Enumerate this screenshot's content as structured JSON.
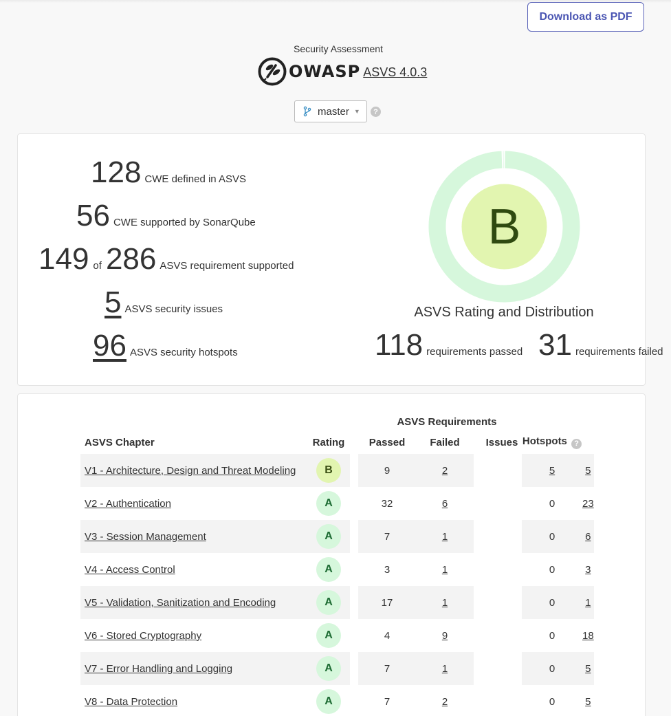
{
  "header": {
    "download_label": "Download as PDF",
    "assessment_label": "Security Assessment",
    "owasp_logo_text": "OWASP",
    "standard_link": "ASVS 4.0.3",
    "branch": "master"
  },
  "summary": {
    "cwe_defined": {
      "value": "128",
      "label": "CWE defined in ASVS"
    },
    "cwe_supported": {
      "value": "56",
      "label": "CWE supported by SonarQube"
    },
    "requirements": {
      "supported": "149",
      "of_label": "of",
      "total": "286",
      "label": "ASVS requirement supported"
    },
    "issues": {
      "value": "5",
      "label": "ASVS security issues"
    },
    "hotspots": {
      "value": "96",
      "label": "ASVS security hotspots"
    }
  },
  "rating": {
    "grade": "B",
    "title": "ASVS Rating and Distribution",
    "passed_value": "118",
    "passed_label": "requirements passed",
    "failed_value": "31",
    "failed_label": "requirements failed",
    "passed_fraction": 0.9958,
    "colors": {
      "ring": "#d6f7dc",
      "inner": "#e2f5b0",
      "ring_failed": "#d6f7dc",
      "grade_text": "#2f4a10"
    }
  },
  "table": {
    "group_header": "ASVS Requirements",
    "columns": {
      "chapter": "ASVS Chapter",
      "rating": "Rating",
      "passed": "Passed",
      "failed": "Failed",
      "issues": "Issues",
      "hotspots": "Hotspots"
    },
    "rows": [
      {
        "chapter": "V1 - Architecture, Design and Threat Modeling",
        "rating": "B",
        "passed": "9",
        "failed": "2",
        "issues": "5",
        "hotspots": "5"
      },
      {
        "chapter": "V2 - Authentication",
        "rating": "A",
        "passed": "32",
        "failed": "6",
        "issues": "0",
        "hotspots": "23"
      },
      {
        "chapter": "V3 - Session Management",
        "rating": "A",
        "passed": "7",
        "failed": "1",
        "issues": "0",
        "hotspots": "6"
      },
      {
        "chapter": "V4 - Access Control",
        "rating": "A",
        "passed": "3",
        "failed": "1",
        "issues": "0",
        "hotspots": "3"
      },
      {
        "chapter": "V5 - Validation, Sanitization and Encoding",
        "rating": "A",
        "passed": "17",
        "failed": "1",
        "issues": "0",
        "hotspots": "1"
      },
      {
        "chapter": "V6 - Stored Cryptography",
        "rating": "A",
        "passed": "4",
        "failed": "9",
        "issues": "0",
        "hotspots": "18"
      },
      {
        "chapter": "V7 - Error Handling and Logging",
        "rating": "A",
        "passed": "7",
        "failed": "1",
        "issues": "0",
        "hotspots": "5"
      },
      {
        "chapter": "V8 - Data Protection",
        "rating": "A",
        "passed": "7",
        "failed": "2",
        "issues": "0",
        "hotspots": "5"
      }
    ]
  }
}
